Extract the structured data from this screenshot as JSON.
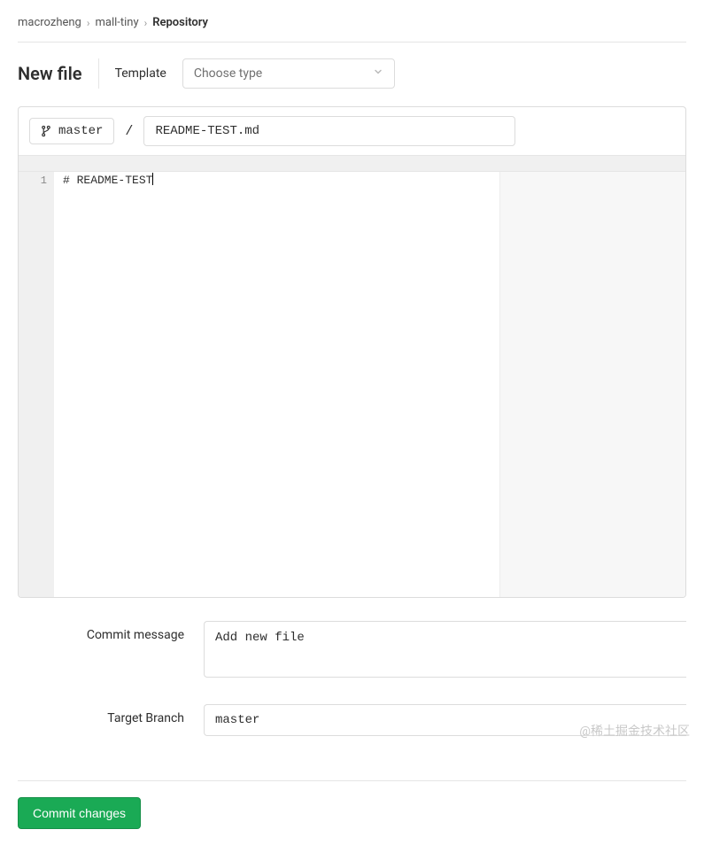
{
  "breadcrumb": {
    "owner": "macrozheng",
    "repo": "mall-tiny",
    "current": "Repository"
  },
  "page": {
    "title": "New file",
    "template_label": "Template",
    "template_placeholder": "Choose type"
  },
  "editor": {
    "branch": "master",
    "path_separator": "/",
    "filename": "README-TEST.md",
    "line_number": "1",
    "content": "# README-TEST"
  },
  "form": {
    "commit_message_label": "Commit message",
    "commit_message_value": "Add new file",
    "target_branch_label": "Target Branch",
    "target_branch_value": "master"
  },
  "actions": {
    "commit": "Commit changes"
  },
  "watermark": "@稀土掘金技术社区"
}
